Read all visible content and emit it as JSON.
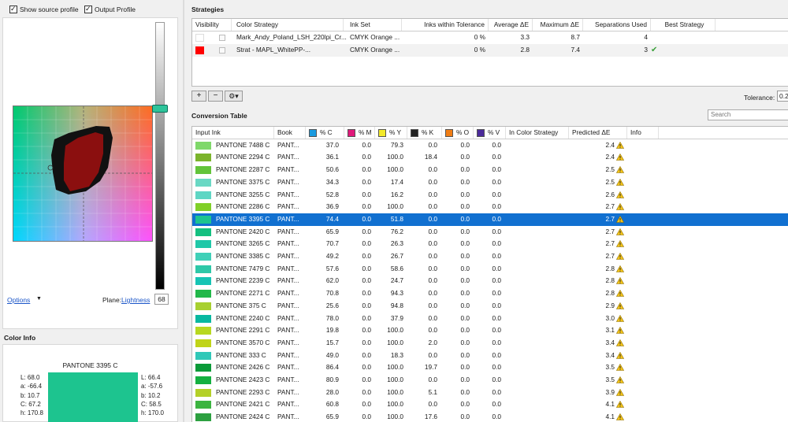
{
  "left": {
    "show_source_profile": "Show source profile",
    "output_profile": "Output Profile",
    "options": "Options",
    "plane_label": "Plane:",
    "plane_mode": "Lightness",
    "plane_value": "68"
  },
  "color_info": {
    "title": "Color Info",
    "name": "PANTONE 3395 C",
    "left_values": [
      "L: 68.0",
      "a: -66.4",
      "b: 10.7",
      "C: 67.2",
      "h: 170.8"
    ],
    "right_values": [
      "L: 66.4",
      "a: -57.6",
      "b: 10.2",
      "C: 58.5",
      "h: 170.0"
    ],
    "swatch_color": "#1dc48f"
  },
  "strategies": {
    "title": "Strategies",
    "headers": [
      "Visibility",
      "Color Strategy",
      "Ink Set",
      "Inks within Tolerance",
      "Average ΔE",
      "Maximum ΔE",
      "Separations Used",
      "Best Strategy"
    ],
    "rows": [
      {
        "color": "#ffffff",
        "strategy": "Mark_Andy_Poland_LSH_220lpi_Cr...",
        "ink_set": "CMYK Orange ...",
        "within": "0 %",
        "avg": "3.3",
        "max": "8.7",
        "seps": "4",
        "best": ""
      },
      {
        "color": "#ff0000",
        "strategy": "Strat - MAPL_WhitePP-...",
        "ink_set": "CMYK Orange ...",
        "within": "0 %",
        "avg": "2.8",
        "max": "7.4",
        "seps": "3",
        "best": "✔"
      }
    ],
    "add": "+",
    "remove": "−",
    "gear": "⚙▾",
    "tolerance_label": "Tolerance:",
    "tolerance_value": "0.2"
  },
  "conversion": {
    "title": "Conversion Table",
    "search_placeholder": "Search",
    "headers": {
      "input": "Input Ink",
      "book": "Book",
      "c": "% C",
      "m": "% M",
      "y": "% Y",
      "k": "% K",
      "o": "% O",
      "v": "% V",
      "in_strategy": "In Color Strategy",
      "predicted": "Predicted ΔE",
      "info": "Info"
    },
    "ink_colors": {
      "c": "#1a9be0",
      "m": "#e0187a",
      "y": "#f3e92a",
      "k": "#222222",
      "o": "#f07d14",
      "v": "#4a2a9a"
    },
    "rows": [
      {
        "sw": "#7fd86a",
        "name": "PANTONE 7488 C",
        "book": "PANT...",
        "c": "37.0",
        "m": "0.0",
        "y": "79.3",
        "k": "0.0",
        "o": "0.0",
        "v": "0.0",
        "de": "2.4"
      },
      {
        "sw": "#7bb42c",
        "name": "PANTONE 2294 C",
        "book": "PANT...",
        "c": "36.1",
        "m": "0.0",
        "y": "100.0",
        "k": "18.4",
        "o": "0.0",
        "v": "0.0",
        "de": "2.4"
      },
      {
        "sw": "#63c43a",
        "name": "PANTONE 2287 C",
        "book": "PANT...",
        "c": "50.6",
        "m": "0.0",
        "y": "100.0",
        "k": "0.0",
        "o": "0.0",
        "v": "0.0",
        "de": "2.5"
      },
      {
        "sw": "#6ad8c4",
        "name": "PANTONE 3375 C",
        "book": "PANT...",
        "c": "34.3",
        "m": "0.0",
        "y": "17.4",
        "k": "0.0",
        "o": "0.0",
        "v": "0.0",
        "de": "2.5"
      },
      {
        "sw": "#5fd6c4",
        "name": "PANTONE 3255 C",
        "book": "PANT...",
        "c": "52.8",
        "m": "0.0",
        "y": "16.2",
        "k": "0.0",
        "o": "0.0",
        "v": "0.0",
        "de": "2.6"
      },
      {
        "sw": "#80d028",
        "name": "PANTONE 2286 C",
        "book": "PANT...",
        "c": "36.9",
        "m": "0.0",
        "y": "100.0",
        "k": "0.0",
        "o": "0.0",
        "v": "0.0",
        "de": "2.7"
      },
      {
        "sw": "#1dc48f",
        "name": "PANTONE 3395 C",
        "book": "PANT...",
        "c": "74.4",
        "m": "0.0",
        "y": "51.8",
        "k": "0.0",
        "o": "0.0",
        "v": "0.0",
        "de": "2.7",
        "selected": true
      },
      {
        "sw": "#14c080",
        "name": "PANTONE 2420 C",
        "book": "PANT...",
        "c": "65.9",
        "m": "0.0",
        "y": "76.2",
        "k": "0.0",
        "o": "0.0",
        "v": "0.0",
        "de": "2.7"
      },
      {
        "sw": "#20c8a8",
        "name": "PANTONE 3265 C",
        "book": "PANT...",
        "c": "70.7",
        "m": "0.0",
        "y": "26.3",
        "k": "0.0",
        "o": "0.0",
        "v": "0.0",
        "de": "2.7"
      },
      {
        "sw": "#40d0b8",
        "name": "PANTONE 3385 C",
        "book": "PANT...",
        "c": "49.2",
        "m": "0.0",
        "y": "26.7",
        "k": "0.0",
        "o": "0.0",
        "v": "0.0",
        "de": "2.7"
      },
      {
        "sw": "#2ec8a8",
        "name": "PANTONE 7479 C",
        "book": "PANT...",
        "c": "57.6",
        "m": "0.0",
        "y": "58.6",
        "k": "0.0",
        "o": "0.0",
        "v": "0.0",
        "de": "2.8"
      },
      {
        "sw": "#16c4b4",
        "name": "PANTONE 2239 C",
        "book": "PANT...",
        "c": "62.0",
        "m": "0.0",
        "y": "24.7",
        "k": "0.0",
        "o": "0.0",
        "v": "0.0",
        "de": "2.8"
      },
      {
        "sw": "#22b84a",
        "name": "PANTONE 2271 C",
        "book": "PANT...",
        "c": "70.8",
        "m": "0.0",
        "y": "94.3",
        "k": "0.0",
        "o": "0.0",
        "v": "0.0",
        "de": "2.8"
      },
      {
        "sw": "#a8d030",
        "name": "PANTONE 375 C",
        "book": "PANT...",
        "c": "25.6",
        "m": "0.0",
        "y": "94.8",
        "k": "0.0",
        "o": "0.0",
        "v": "0.0",
        "de": "2.9"
      },
      {
        "sw": "#08b8a0",
        "name": "PANTONE 2240 C",
        "book": "PANT...",
        "c": "78.0",
        "m": "0.0",
        "y": "37.9",
        "k": "0.0",
        "o": "0.0",
        "v": "0.0",
        "de": "3.0"
      },
      {
        "sw": "#b8d820",
        "name": "PANTONE 2291 C",
        "book": "PANT...",
        "c": "19.8",
        "m": "0.0",
        "y": "100.0",
        "k": "0.0",
        "o": "0.0",
        "v": "0.0",
        "de": "3.1"
      },
      {
        "sw": "#c0d418",
        "name": "PANTONE 3570 C",
        "book": "PANT...",
        "c": "15.7",
        "m": "0.0",
        "y": "100.0",
        "k": "2.0",
        "o": "0.0",
        "v": "0.0",
        "de": "3.4"
      },
      {
        "sw": "#30c8b8",
        "name": "PANTONE 333 C",
        "book": "PANT...",
        "c": "49.0",
        "m": "0.0",
        "y": "18.3",
        "k": "0.0",
        "o": "0.0",
        "v": "0.0",
        "de": "3.4"
      },
      {
        "sw": "#0a9a38",
        "name": "PANTONE 2426 C",
        "book": "PANT...",
        "c": "86.4",
        "m": "0.0",
        "y": "100.0",
        "k": "19.7",
        "o": "0.0",
        "v": "0.0",
        "de": "3.5"
      },
      {
        "sw": "#14b040",
        "name": "PANTONE 2423 C",
        "book": "PANT...",
        "c": "80.9",
        "m": "0.0",
        "y": "100.0",
        "k": "0.0",
        "o": "0.0",
        "v": "0.0",
        "de": "3.5"
      },
      {
        "sw": "#b4d028",
        "name": "PANTONE 2293 C",
        "book": "PANT...",
        "c": "28.0",
        "m": "0.0",
        "y": "100.0",
        "k": "5.1",
        "o": "0.0",
        "v": "0.0",
        "de": "3.9"
      },
      {
        "sw": "#3cb440",
        "name": "PANTONE 2421 C",
        "book": "PANT...",
        "c": "60.8",
        "m": "0.0",
        "y": "100.0",
        "k": "0.0",
        "o": "0.0",
        "v": "0.0",
        "de": "4.1"
      },
      {
        "sw": "#2ca040",
        "name": "PANTONE 2424 C",
        "book": "PANT...",
        "c": "65.9",
        "m": "0.0",
        "y": "100.0",
        "k": "17.6",
        "o": "0.0",
        "v": "0.0",
        "de": "4.1"
      }
    ]
  }
}
